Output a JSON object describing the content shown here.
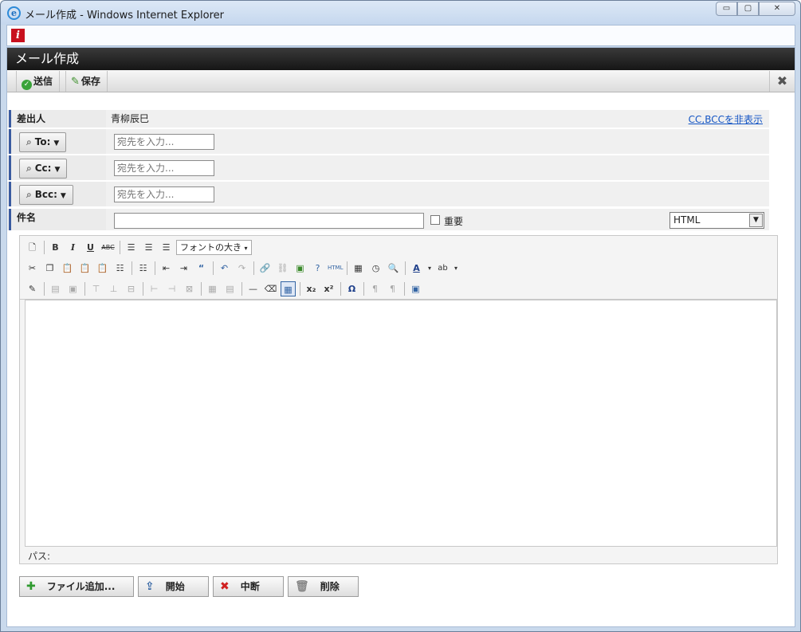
{
  "window": {
    "title": "メール作成 - Windows Internet Explorer",
    "minimize": "▭",
    "maximize": "▢",
    "close": "✕"
  },
  "app": {
    "icon_letter": "i",
    "header": "メール作成"
  },
  "toolbar": {
    "send_label": "送信",
    "save_label": "保存",
    "close_symbol": "✖"
  },
  "form": {
    "from_label": "差出人",
    "from_value": "青柳辰巳",
    "toggle_cc_link": "CC,BCCを非表示",
    "to_label": "To:",
    "cc_label": "Cc:",
    "bcc_label": "Bcc:",
    "recipient_placeholder": "宛先を入力...",
    "subject_label": "件名",
    "important_label": "重要",
    "format_value": "HTML"
  },
  "editor": {
    "font_size_label": "フォントの大き",
    "path_label": "パス:"
  },
  "buttons": {
    "add_file": "ファイル追加...",
    "start": "開始",
    "stop": "中断",
    "delete": "削除"
  }
}
